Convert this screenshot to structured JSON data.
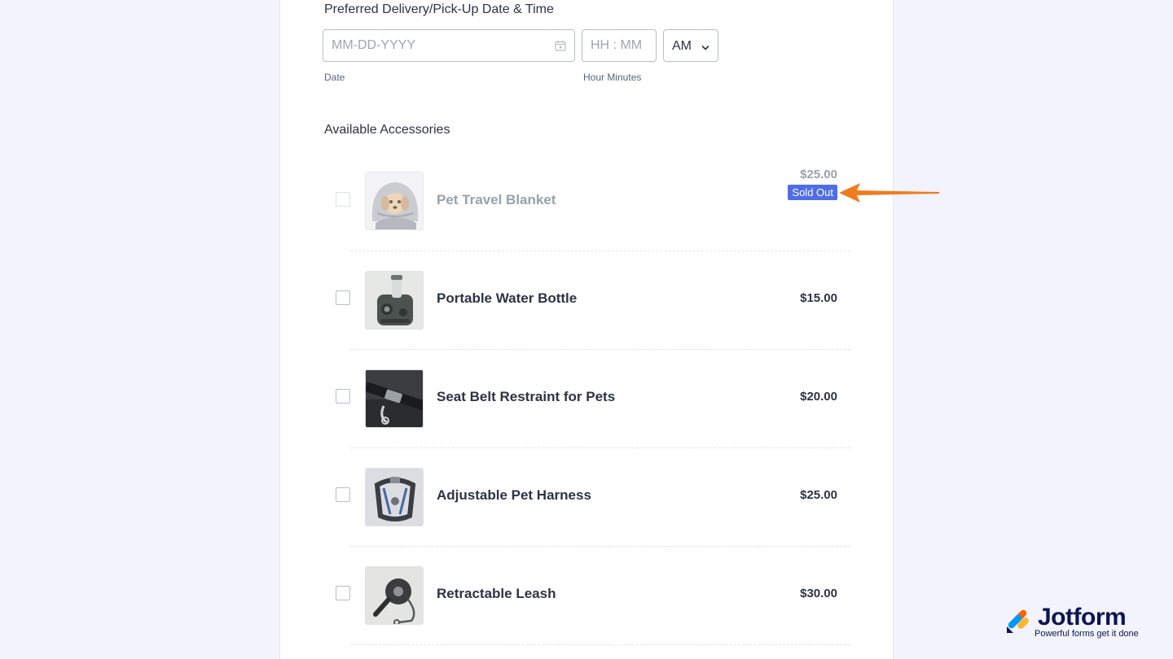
{
  "datetime": {
    "label": "Preferred Delivery/Pick-Up Date & Time",
    "date_placeholder": "MM-DD-YYYY",
    "date_sublabel": "Date",
    "time_placeholder": "HH : MM",
    "time_sublabel": "Hour Minutes",
    "ampm_value": "AM"
  },
  "accessories": {
    "label": "Available Accessories",
    "items": [
      {
        "name": "Pet Travel Blanket",
        "price": "$25.00",
        "badge": "Sold Out",
        "icon": "blanket-puppy-image"
      },
      {
        "name": "Portable Water Bottle",
        "price": "$15.00",
        "icon": "water-bottle-image"
      },
      {
        "name": "Seat Belt Restraint for Pets",
        "price": "$20.00",
        "icon": "seat-belt-image"
      },
      {
        "name": "Adjustable Pet Harness",
        "price": "$25.00",
        "icon": "harness-image"
      },
      {
        "name": "Retractable Leash",
        "price": "$30.00",
        "icon": "leash-image"
      }
    ]
  },
  "branding": {
    "name": "Jotform",
    "tagline": "Powerful forms get it done"
  },
  "colors": {
    "badge": "#4f6de8",
    "arrow": "#f07c1e",
    "brand_navy": "#0a1551"
  }
}
